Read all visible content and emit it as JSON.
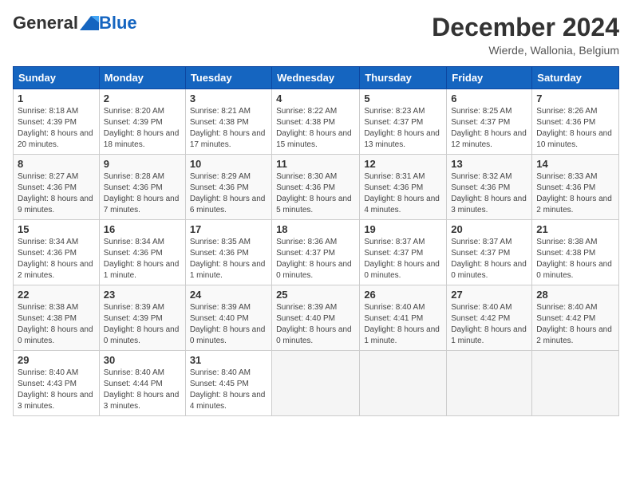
{
  "header": {
    "logo_general": "General",
    "logo_blue": "Blue",
    "month_title": "December 2024",
    "location": "Wierde, Wallonia, Belgium"
  },
  "days_of_week": [
    "Sunday",
    "Monday",
    "Tuesday",
    "Wednesday",
    "Thursday",
    "Friday",
    "Saturday"
  ],
  "weeks": [
    [
      {
        "day": "1",
        "sunrise": "8:18 AM",
        "sunset": "4:39 PM",
        "daylight": "8 hours and 20 minutes"
      },
      {
        "day": "2",
        "sunrise": "8:20 AM",
        "sunset": "4:39 PM",
        "daylight": "8 hours and 18 minutes"
      },
      {
        "day": "3",
        "sunrise": "8:21 AM",
        "sunset": "4:38 PM",
        "daylight": "8 hours and 17 minutes"
      },
      {
        "day": "4",
        "sunrise": "8:22 AM",
        "sunset": "4:38 PM",
        "daylight": "8 hours and 15 minutes"
      },
      {
        "day": "5",
        "sunrise": "8:23 AM",
        "sunset": "4:37 PM",
        "daylight": "8 hours and 13 minutes"
      },
      {
        "day": "6",
        "sunrise": "8:25 AM",
        "sunset": "4:37 PM",
        "daylight": "8 hours and 12 minutes"
      },
      {
        "day": "7",
        "sunrise": "8:26 AM",
        "sunset": "4:36 PM",
        "daylight": "8 hours and 10 minutes"
      }
    ],
    [
      {
        "day": "8",
        "sunrise": "8:27 AM",
        "sunset": "4:36 PM",
        "daylight": "8 hours and 9 minutes"
      },
      {
        "day": "9",
        "sunrise": "8:28 AM",
        "sunset": "4:36 PM",
        "daylight": "8 hours and 7 minutes"
      },
      {
        "day": "10",
        "sunrise": "8:29 AM",
        "sunset": "4:36 PM",
        "daylight": "8 hours and 6 minutes"
      },
      {
        "day": "11",
        "sunrise": "8:30 AM",
        "sunset": "4:36 PM",
        "daylight": "8 hours and 5 minutes"
      },
      {
        "day": "12",
        "sunrise": "8:31 AM",
        "sunset": "4:36 PM",
        "daylight": "8 hours and 4 minutes"
      },
      {
        "day": "13",
        "sunrise": "8:32 AM",
        "sunset": "4:36 PM",
        "daylight": "8 hours and 3 minutes"
      },
      {
        "day": "14",
        "sunrise": "8:33 AM",
        "sunset": "4:36 PM",
        "daylight": "8 hours and 2 minutes"
      }
    ],
    [
      {
        "day": "15",
        "sunrise": "8:34 AM",
        "sunset": "4:36 PM",
        "daylight": "8 hours and 2 minutes"
      },
      {
        "day": "16",
        "sunrise": "8:34 AM",
        "sunset": "4:36 PM",
        "daylight": "8 hours and 1 minute"
      },
      {
        "day": "17",
        "sunrise": "8:35 AM",
        "sunset": "4:36 PM",
        "daylight": "8 hours and 1 minute"
      },
      {
        "day": "18",
        "sunrise": "8:36 AM",
        "sunset": "4:37 PM",
        "daylight": "8 hours and 0 minutes"
      },
      {
        "day": "19",
        "sunrise": "8:37 AM",
        "sunset": "4:37 PM",
        "daylight": "8 hours and 0 minutes"
      },
      {
        "day": "20",
        "sunrise": "8:37 AM",
        "sunset": "4:37 PM",
        "daylight": "8 hours and 0 minutes"
      },
      {
        "day": "21",
        "sunrise": "8:38 AM",
        "sunset": "4:38 PM",
        "daylight": "8 hours and 0 minutes"
      }
    ],
    [
      {
        "day": "22",
        "sunrise": "8:38 AM",
        "sunset": "4:38 PM",
        "daylight": "8 hours and 0 minutes"
      },
      {
        "day": "23",
        "sunrise": "8:39 AM",
        "sunset": "4:39 PM",
        "daylight": "8 hours and 0 minutes"
      },
      {
        "day": "24",
        "sunrise": "8:39 AM",
        "sunset": "4:40 PM",
        "daylight": "8 hours and 0 minutes"
      },
      {
        "day": "25",
        "sunrise": "8:39 AM",
        "sunset": "4:40 PM",
        "daylight": "8 hours and 0 minutes"
      },
      {
        "day": "26",
        "sunrise": "8:40 AM",
        "sunset": "4:41 PM",
        "daylight": "8 hours and 1 minute"
      },
      {
        "day": "27",
        "sunrise": "8:40 AM",
        "sunset": "4:42 PM",
        "daylight": "8 hours and 1 minute"
      },
      {
        "day": "28",
        "sunrise": "8:40 AM",
        "sunset": "4:42 PM",
        "daylight": "8 hours and 2 minutes"
      }
    ],
    [
      {
        "day": "29",
        "sunrise": "8:40 AM",
        "sunset": "4:43 PM",
        "daylight": "8 hours and 3 minutes"
      },
      {
        "day": "30",
        "sunrise": "8:40 AM",
        "sunset": "4:44 PM",
        "daylight": "8 hours and 3 minutes"
      },
      {
        "day": "31",
        "sunrise": "8:40 AM",
        "sunset": "4:45 PM",
        "daylight": "8 hours and 4 minutes"
      },
      null,
      null,
      null,
      null
    ]
  ]
}
